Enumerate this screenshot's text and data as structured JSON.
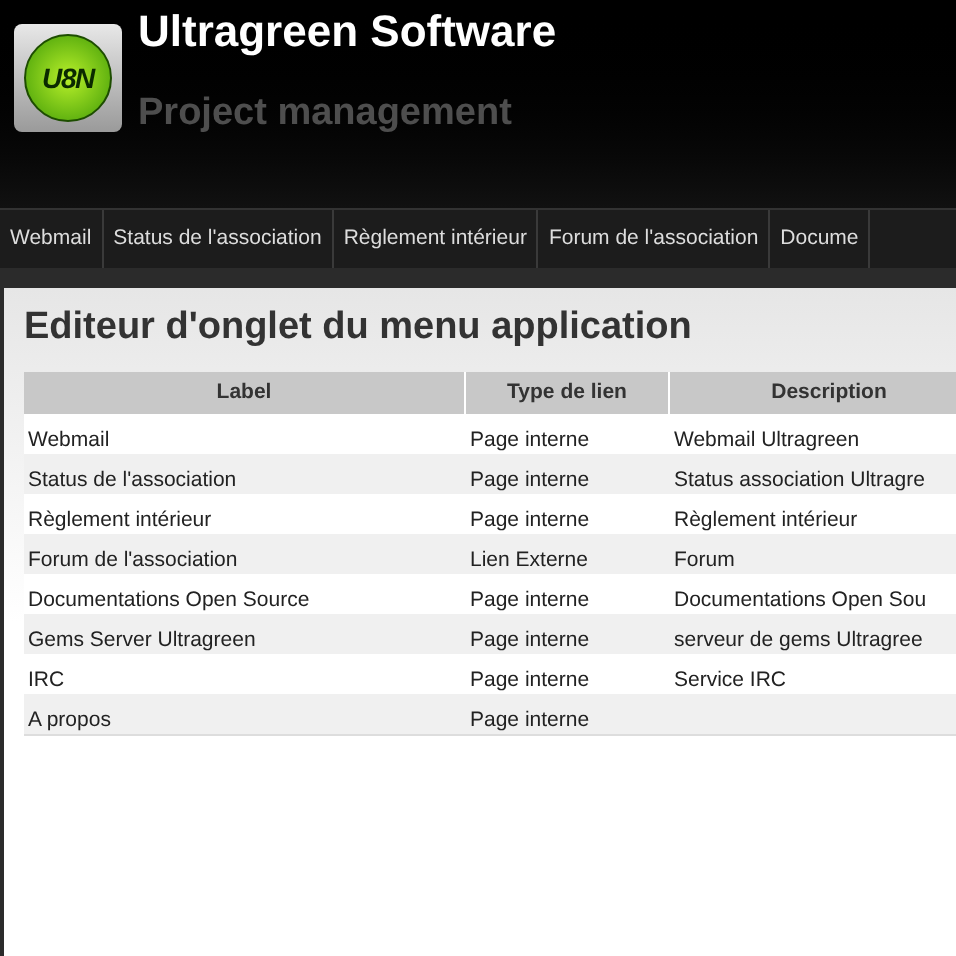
{
  "header": {
    "logo_text": "U8N",
    "title": "Ultragreen Software",
    "subtitle": "Project management"
  },
  "nav": [
    {
      "label": "Webmail"
    },
    {
      "label": "Status de l'association"
    },
    {
      "label": "Règlement intérieur"
    },
    {
      "label": "Forum de l'association"
    },
    {
      "label": "Docume"
    }
  ],
  "panel": {
    "title": "Editeur d'onglet du menu application"
  },
  "table": {
    "columns": [
      "Label",
      "Type de lien",
      "Description"
    ],
    "rows": [
      [
        "Webmail",
        "Page interne",
        "Webmail Ultragreen"
      ],
      [
        "Status de l'association",
        "Page interne",
        "Status association Ultragre"
      ],
      [
        "Règlement intérieur",
        "Page interne",
        "Règlement intérieur"
      ],
      [
        "Forum de l'association",
        "Lien Externe",
        "Forum"
      ],
      [
        "Documentations Open Source",
        "Page interne",
        "Documentations Open Sou"
      ],
      [
        "Gems Server Ultragreen",
        "Page interne",
        "serveur de gems Ultragree"
      ],
      [
        "IRC",
        "Page interne",
        "Service IRC"
      ],
      [
        "A propos",
        "Page interne",
        ""
      ]
    ]
  }
}
